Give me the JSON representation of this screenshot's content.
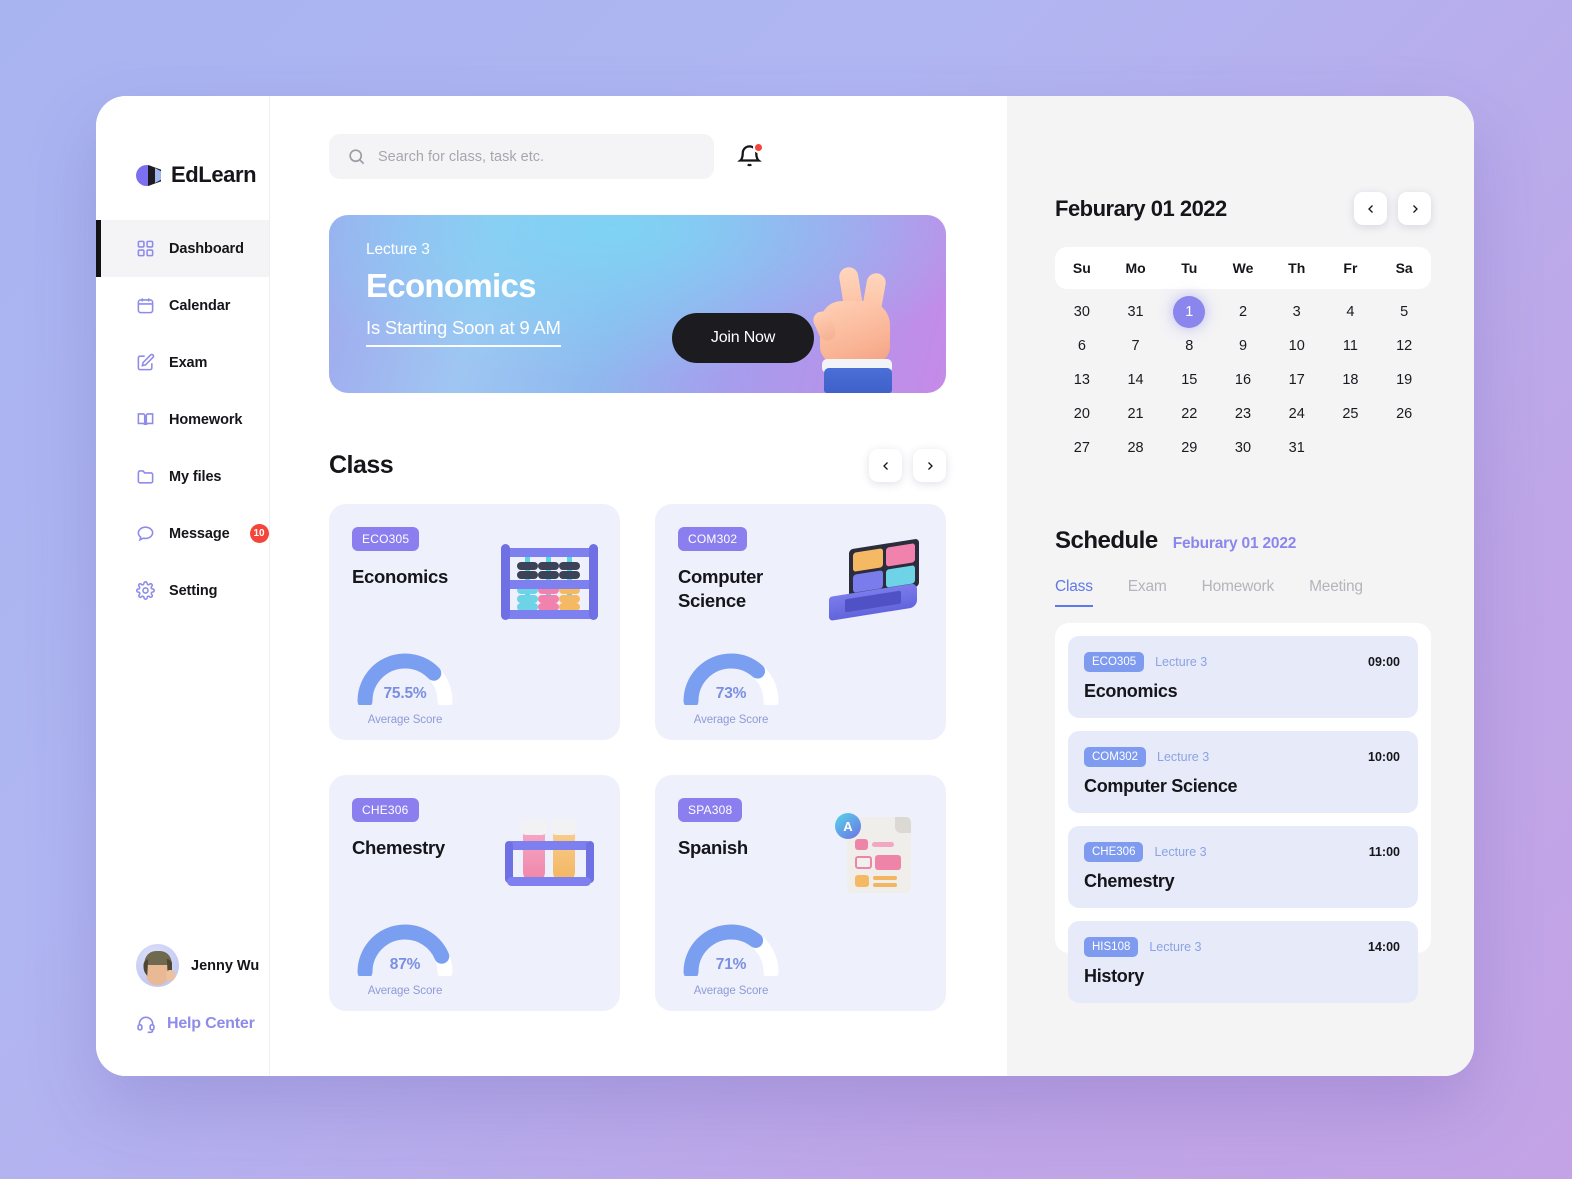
{
  "brand": {
    "name": "EdLearn"
  },
  "sidebar": {
    "items": [
      {
        "label": "Dashboard",
        "icon": "grid-icon",
        "active": true
      },
      {
        "label": "Calendar",
        "icon": "calendar-icon",
        "active": false
      },
      {
        "label": "Exam",
        "icon": "edit-square-icon",
        "active": false
      },
      {
        "label": "Homework",
        "icon": "book-icon",
        "active": false
      },
      {
        "label": "My files",
        "icon": "folder-icon",
        "active": false
      },
      {
        "label": "Message",
        "icon": "chat-bubble-icon",
        "active": false,
        "badge": "10"
      },
      {
        "label": "Setting",
        "icon": "gear-icon",
        "active": false
      }
    ],
    "profile": {
      "name": "Jenny Wu"
    },
    "help": {
      "label": "Help Center",
      "icon": "headset-icon"
    }
  },
  "topbar": {
    "search": {
      "placeholder": "Search for class, task etc.",
      "value": ""
    },
    "notification": {
      "icon": "bell-icon",
      "has_unread": true
    }
  },
  "hero": {
    "eyebrow": "Lecture 3",
    "title": "Economics",
    "subtitle": "Is Starting Soon at 9 AM",
    "cta": "Join Now"
  },
  "class_section": {
    "title": "Class",
    "prev_label": "‹",
    "next_label": "›",
    "cards": [
      {
        "code": "ECO305",
        "name": "Economics",
        "score": "75.5%",
        "score_pct": 75.5,
        "score_label": "Average Score",
        "illo": "abacus-illustration"
      },
      {
        "code": "COM302",
        "name": "Computer Science",
        "score": "73%",
        "score_pct": 73,
        "score_label": "Average Score",
        "illo": "laptop-illustration"
      },
      {
        "code": "CHE306",
        "name": "Chemestry",
        "score": "87%",
        "score_pct": 87,
        "score_label": "Average Score",
        "illo": "test-tubes-illustration"
      },
      {
        "code": "SPA308",
        "name": "Spanish",
        "score": "71%",
        "score_pct": 71,
        "score_label": "Average Score",
        "illo": "document-illustration"
      }
    ]
  },
  "calendar": {
    "title": "Feburary 01 2022",
    "prev_label": "‹",
    "next_label": "›",
    "dow": [
      "Su",
      "Mo",
      "Tu",
      "We",
      "Th",
      "Fr",
      "Sa"
    ],
    "days": [
      {
        "n": "30",
        "muted": true
      },
      {
        "n": "31",
        "muted": true
      },
      {
        "n": "1",
        "selected": true
      },
      {
        "n": "2"
      },
      {
        "n": "3"
      },
      {
        "n": "4"
      },
      {
        "n": "5"
      },
      {
        "n": "6"
      },
      {
        "n": "7"
      },
      {
        "n": "8"
      },
      {
        "n": "9"
      },
      {
        "n": "10"
      },
      {
        "n": "11"
      },
      {
        "n": "12"
      },
      {
        "n": "13"
      },
      {
        "n": "14"
      },
      {
        "n": "15"
      },
      {
        "n": "16"
      },
      {
        "n": "17"
      },
      {
        "n": "18"
      },
      {
        "n": "19"
      },
      {
        "n": "20"
      },
      {
        "n": "21"
      },
      {
        "n": "22"
      },
      {
        "n": "23"
      },
      {
        "n": "24"
      },
      {
        "n": "25"
      },
      {
        "n": "26"
      },
      {
        "n": "27"
      },
      {
        "n": "28"
      },
      {
        "n": "29"
      },
      {
        "n": "30"
      },
      {
        "n": "31"
      },
      {
        "n": ""
      },
      {
        "n": ""
      }
    ]
  },
  "schedule": {
    "title": "Schedule",
    "date": "Feburary 01 2022",
    "tabs": [
      {
        "label": "Class",
        "active": true
      },
      {
        "label": "Exam",
        "active": false
      },
      {
        "label": "Homework",
        "active": false
      },
      {
        "label": "Meeting",
        "active": false
      }
    ],
    "items": [
      {
        "code": "ECO305",
        "lecture": "Lecture 3",
        "time": "09:00",
        "name": "Economics"
      },
      {
        "code": "COM302",
        "lecture": "Lecture 3",
        "time": "10:00",
        "name": "Computer Science"
      },
      {
        "code": "CHE306",
        "lecture": "Lecture 3",
        "time": "11:00",
        "name": "Chemestry"
      },
      {
        "code": "HIS108",
        "lecture": "Lecture 3",
        "time": "14:00",
        "name": "History"
      }
    ]
  },
  "colors": {
    "brand_purple": "#7c6ff0",
    "accent_blue": "#5f79e8",
    "gauge_blue": "#7a9ef0",
    "badge_red": "#f4453a",
    "card_bg": "#eef0fc",
    "panel_bg": "#f4f4f5"
  }
}
